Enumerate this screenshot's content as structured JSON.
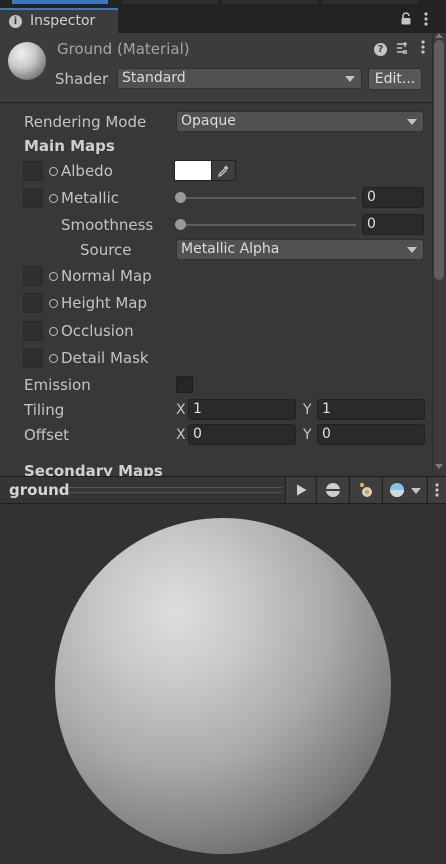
{
  "tab": {
    "title": "Inspector"
  },
  "header": {
    "material_title": "Ground (Material)",
    "shader_label": "Shader",
    "shader_value": "Standard",
    "edit_button": "Edit..."
  },
  "properties": {
    "rendering_mode_label": "Rendering Mode",
    "rendering_mode_value": "Opaque",
    "main_maps_heading": "Main Maps",
    "albedo_label": "Albedo",
    "albedo_color": "#ffffff",
    "metallic_label": "Metallic",
    "metallic_value": "0",
    "smoothness_label": "Smoothness",
    "smoothness_value": "0",
    "source_label": "Source",
    "source_value": "Metallic Alpha",
    "normal_map_label": "Normal Map",
    "height_map_label": "Height Map",
    "occlusion_label": "Occlusion",
    "detail_mask_label": "Detail Mask",
    "emission_label": "Emission",
    "emission_checked": false,
    "tiling_label": "Tiling",
    "tiling_x_axis": "X",
    "tiling_x": "1",
    "tiling_y_axis": "Y",
    "tiling_y": "1",
    "offset_label": "Offset",
    "offset_x_axis": "X",
    "offset_x": "0",
    "offset_y_axis": "Y",
    "offset_y": "0",
    "secondary_maps_heading": "Secondary Maps"
  },
  "preview": {
    "name": "ground",
    "icons": [
      "play-icon",
      "sphere-mesh-icon",
      "light-icon",
      "skybox-icon",
      "kebab-menu-icon"
    ]
  },
  "colors": {
    "panel_bg": "#383838",
    "tab_accent": "#3a79bb",
    "field_bg": "#2a2a2a",
    "dropdown_bg": "#515151"
  }
}
